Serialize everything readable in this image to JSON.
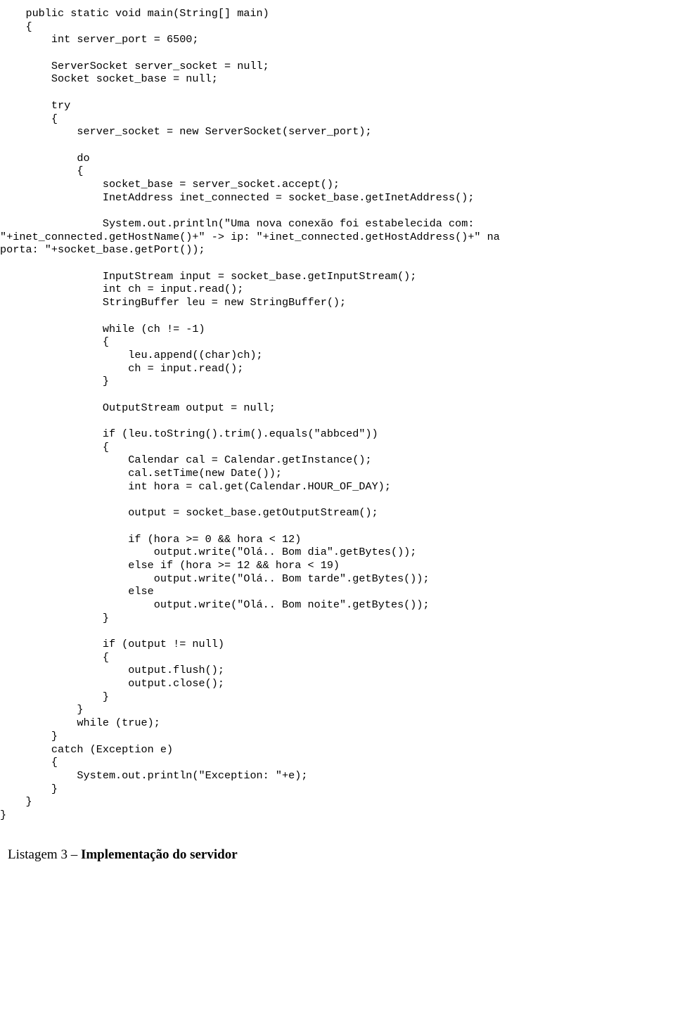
{
  "code": "    public static void main(String[] main)\n    {\n        int server_port = 6500;\n\n        ServerSocket server_socket = null;\n        Socket socket_base = null;\n\n        try\n        {\n            server_socket = new ServerSocket(server_port);\n\n            do\n            {\n                socket_base = server_socket.accept();\n                InetAddress inet_connected = socket_base.getInetAddress();\n\n                System.out.println(\"Uma nova conexão foi estabelecida com:\n\"+inet_connected.getHostName()+\" -> ip: \"+inet_connected.getHostAddress()+\" na\nporta: \"+socket_base.getPort());\n\n                InputStream input = socket_base.getInputStream();\n                int ch = input.read();\n                StringBuffer leu = new StringBuffer();\n\n                while (ch != -1)\n                {\n                    leu.append((char)ch);\n                    ch = input.read();\n                }\n\n                OutputStream output = null;\n\n                if (leu.toString().trim().equals(\"abbced\"))\n                {\n                    Calendar cal = Calendar.getInstance();\n                    cal.setTime(new Date());\n                    int hora = cal.get(Calendar.HOUR_OF_DAY);\n\n                    output = socket_base.getOutputStream();\n\n                    if (hora >= 0 && hora < 12)\n                        output.write(\"Olá.. Bom dia\".getBytes());\n                    else if (hora >= 12 && hora < 19)\n                        output.write(\"Olá.. Bom tarde\".getBytes());\n                    else\n                        output.write(\"Olá.. Bom noite\".getBytes());\n                }\n\n                if (output != null)\n                {\n                    output.flush();\n                    output.close();\n                }\n            }\n            while (true);\n        }\n        catch (Exception e)\n        {\n            System.out.println(\"Exception: \"+e);\n        }\n    }\n}",
  "caption_prefix": "Listagem 3 – ",
  "caption_title": "Implementação do servidor"
}
